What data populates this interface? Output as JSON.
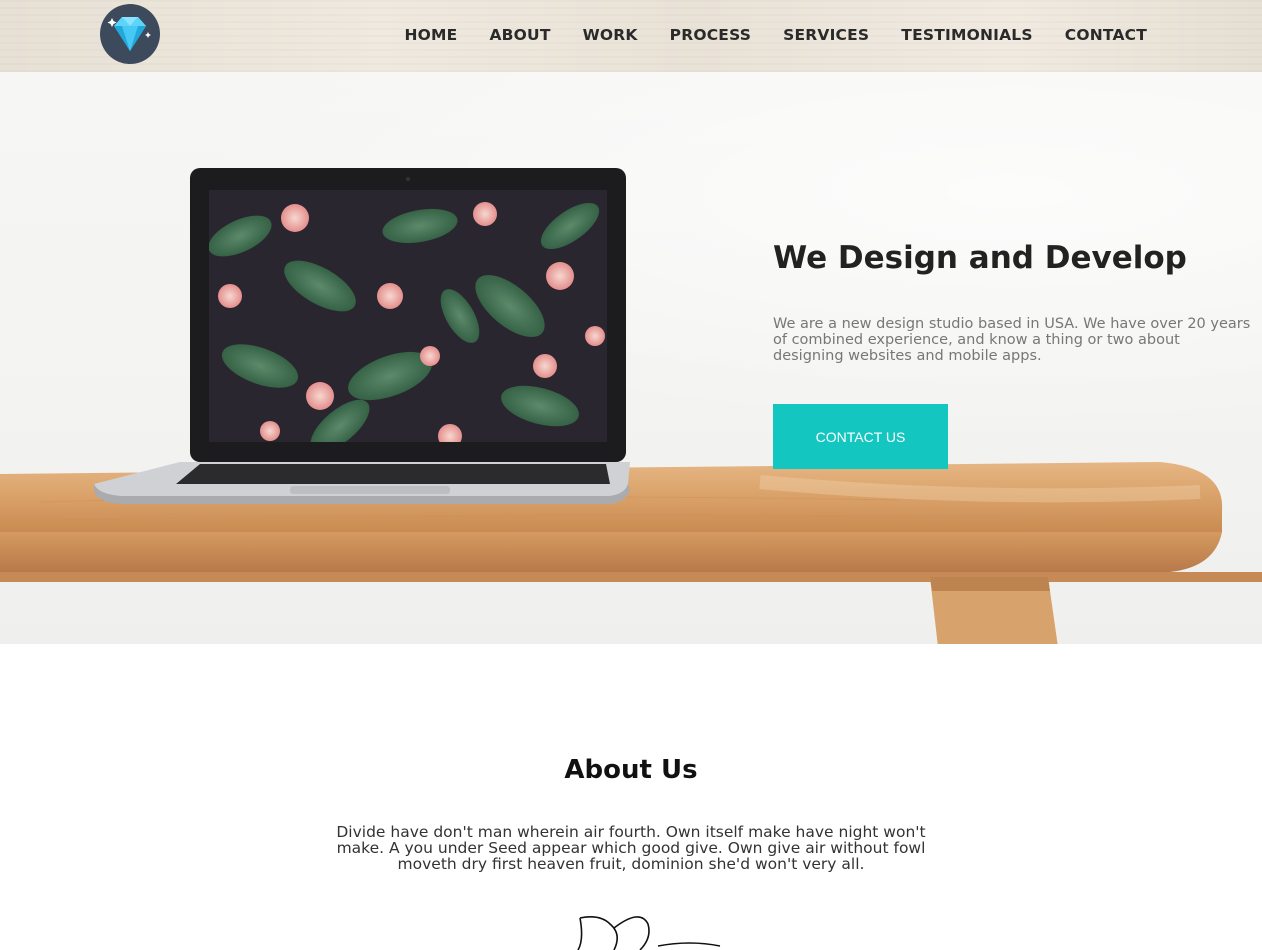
{
  "header": {
    "logo_icon": "diamond-icon",
    "nav": [
      "HOME",
      "ABOUT",
      "WORK",
      "PROCESS",
      "SERVICES",
      "TESTIMONIALS",
      "CONTACT"
    ]
  },
  "hero": {
    "title": "We Design and Develop",
    "description": "We are a new design studio based in USA. We have over 20 years of combined experience, and know a thing or two about designing websites and mobile apps.",
    "cta_label": "CONTACT US",
    "accent_color": "#13c6c0"
  },
  "about": {
    "title": "About Us",
    "text": "Divide have don't man wherein air fourth. Own itself make have night won't make. A you under Seed appear which good give. Own give air without fowl moveth dry first heaven fruit, dominion she'd won't very all."
  }
}
